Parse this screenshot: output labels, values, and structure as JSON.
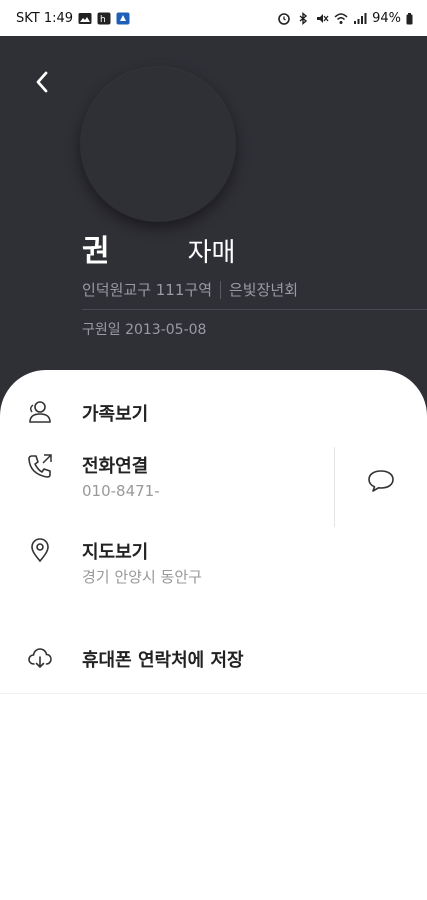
{
  "status_bar": {
    "carrier_time": "SKT 1:49",
    "battery": "94%"
  },
  "profile": {
    "name": "권",
    "relation": "자매",
    "district": "인덕원교구 111구역",
    "group": "은빛장년회",
    "joined": "구원일 2013-05-08"
  },
  "actions": {
    "family": {
      "title": "가족보기",
      "icon": "family-icon"
    },
    "phone": {
      "title": "전화연결",
      "number": "010-8471-",
      "icon": "phone-call-icon"
    },
    "message": {
      "icon": "message-bubble-icon"
    },
    "map": {
      "title": "지도보기",
      "address": "경기 안양시 동안구",
      "icon": "map-pin-icon"
    },
    "save": {
      "title": "휴대폰 연락처에 저장",
      "icon": "cloud-download-icon"
    }
  },
  "colors": {
    "header_bg": "#2f2f36",
    "sheet_bg": "#ffffff",
    "title_text": "#222222",
    "muted_text": "#999999"
  }
}
